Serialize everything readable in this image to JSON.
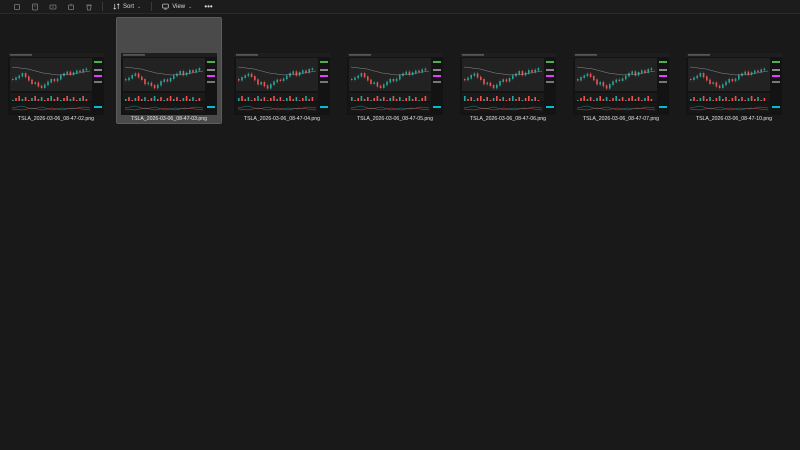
{
  "toolbar": {
    "icons": [
      "copy-icon",
      "paste-icon",
      "rename-icon",
      "share-icon",
      "delete-icon"
    ],
    "sort_label": "Sort",
    "view_label": "View",
    "more_label": "•••"
  },
  "files": [
    {
      "name": "TSLA_2026-03-06_08-47-02.png",
      "selected": false
    },
    {
      "name": "TSLA_2026-03-06_08-47-03.png",
      "selected": true
    },
    {
      "name": "TSLA_2026-03-06_08-47-04.png",
      "selected": false
    },
    {
      "name": "TSLA_2026-03-06_08-47-05.png",
      "selected": false
    },
    {
      "name": "TSLA_2026-03-06_08-47-06.png",
      "selected": false
    },
    {
      "name": "TSLA_2026-03-06_08-47-07.png",
      "selected": false
    },
    {
      "name": "TSLA_2026-03-06_08-47-10.png",
      "selected": false
    }
  ],
  "colors": {
    "up": "#26a69a",
    "down": "#ef5350",
    "green_badge": "#4caf50",
    "pink_badge": "#e040fb",
    "cyan_badge": "#00bcd4"
  }
}
